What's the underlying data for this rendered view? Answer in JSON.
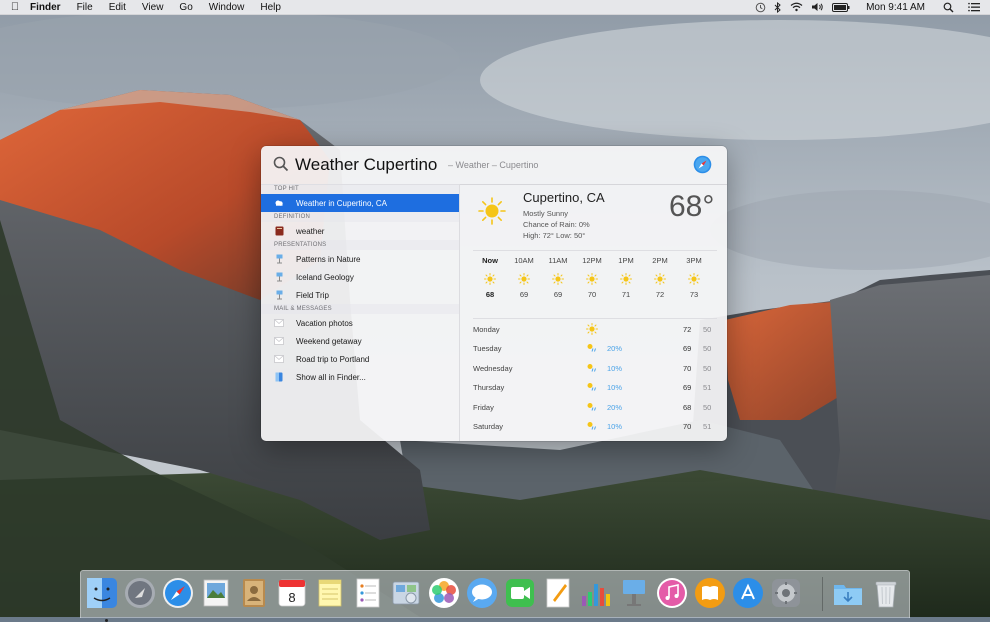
{
  "menubar": {
    "app_name": "Finder",
    "menus": [
      "File",
      "Edit",
      "View",
      "Go",
      "Window",
      "Help"
    ],
    "clock": "Mon 9:41 AM"
  },
  "spotlight": {
    "query": "Weather Cupertino",
    "query_hint": "– Weather – Cupertino",
    "sections": [
      {
        "header": "TOP HIT",
        "items": [
          {
            "label": "Weather in Cupertino, CA",
            "icon": "weather-cloud-icon",
            "selected": true
          }
        ]
      },
      {
        "header": "DEFINITION",
        "items": [
          {
            "label": "weather",
            "icon": "dictionary-icon"
          }
        ]
      },
      {
        "header": "PRESENTATIONS",
        "items": [
          {
            "label": "Patterns in Nature",
            "icon": "keynote-file-icon"
          },
          {
            "label": "Iceland Geology",
            "icon": "keynote-file-icon"
          },
          {
            "label": "Field Trip",
            "icon": "keynote-file-icon"
          }
        ]
      },
      {
        "header": "MAIL & MESSAGES",
        "items": [
          {
            "label": "Vacation photos",
            "icon": "mail-envelope-icon"
          },
          {
            "label": "Weekend getaway",
            "icon": "mail-envelope-icon"
          },
          {
            "label": "Road trip to Portland",
            "icon": "mail-envelope-icon"
          }
        ]
      },
      {
        "header": "",
        "items": [
          {
            "label": "Show all in Finder...",
            "icon": "finder-icon"
          }
        ]
      }
    ]
  },
  "weather": {
    "city": "Cupertino, CA",
    "condition": "Mostly Sunny",
    "rain_chance": "Chance of Rain: 0%",
    "high_low": "High: 72°  Low: 50°",
    "current_temp": "68°",
    "hourly": [
      {
        "label": "Now",
        "temp": "68"
      },
      {
        "label": "10AM",
        "temp": "69"
      },
      {
        "label": "11AM",
        "temp": "69"
      },
      {
        "label": "12PM",
        "temp": "70"
      },
      {
        "label": "1PM",
        "temp": "71"
      },
      {
        "label": "2PM",
        "temp": "72"
      },
      {
        "label": "3PM",
        "temp": "73"
      }
    ],
    "daily": [
      {
        "day": "Monday",
        "icon": "sun-icon",
        "chance": "",
        "high": "72",
        "low": "50"
      },
      {
        "day": "Tuesday",
        "icon": "sun-rain-icon",
        "chance": "20%",
        "high": "69",
        "low": "50"
      },
      {
        "day": "Wednesday",
        "icon": "sun-rain-icon",
        "chance": "10%",
        "high": "70",
        "low": "50"
      },
      {
        "day": "Thursday",
        "icon": "sun-rain-icon",
        "chance": "10%",
        "high": "69",
        "low": "51"
      },
      {
        "day": "Friday",
        "icon": "sun-rain-icon",
        "chance": "20%",
        "high": "68",
        "low": "50"
      },
      {
        "day": "Saturday",
        "icon": "sun-rain-icon",
        "chance": "10%",
        "high": "70",
        "low": "51"
      }
    ]
  },
  "dock": {
    "apps": [
      "Finder",
      "Launchpad",
      "Safari",
      "Preview",
      "Contacts",
      "Calendar",
      "Notes",
      "Reminders",
      "Photo Booth",
      "Photos",
      "Messages",
      "FaceTime",
      "Pages",
      "Numbers",
      "Keynote",
      "iTunes",
      "iBooks",
      "App Store",
      "System Preferences",
      "Downloads",
      "Trash"
    ],
    "calendar_day": "8"
  },
  "colors": {
    "selection": "#1e6ee0",
    "rain_chance": "#4aa3e8",
    "sun": "#f5c518"
  }
}
